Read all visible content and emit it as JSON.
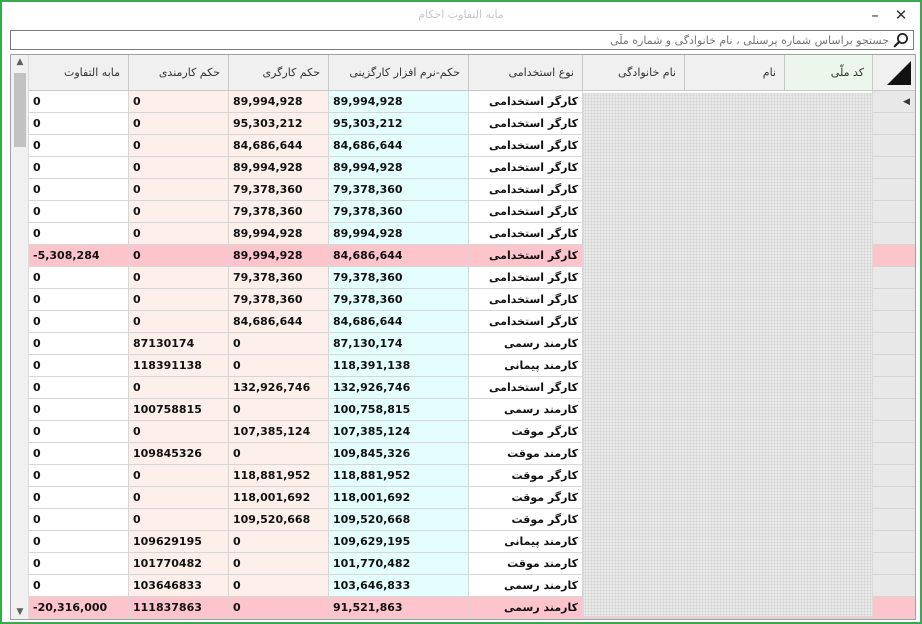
{
  "window": {
    "title": "مابه التفاوت احکام",
    "minimize_icon": "minimize-icon",
    "close_icon": "close-icon"
  },
  "search": {
    "placeholder": "جستجو براساس شماره پرسنلی ، نام خانوادگی و شماره ملّی",
    "icon": "search-icon"
  },
  "table": {
    "columns": {
      "national_code": "کد ملّی",
      "first_name": "نام",
      "last_name": "نام خانوادگی",
      "employment_type": "نوع استخدامی",
      "software_ruling": "حکم-نرم افزار کارگزینی",
      "worker_ruling": "حکم کارگری",
      "employee_ruling": "حکم کارمندی",
      "difference": "مابه التفاوت"
    },
    "rows": [
      {
        "type": "کارگر استخدامی",
        "software": "89,994,928",
        "worker": "89,994,928",
        "employee": "0",
        "diff": "0",
        "highlight": false
      },
      {
        "type": "کارگر استخدامی",
        "software": "95,303,212",
        "worker": "95,303,212",
        "employee": "0",
        "diff": "0",
        "highlight": false
      },
      {
        "type": "کارگر استخدامی",
        "software": "84,686,644",
        "worker": "84,686,644",
        "employee": "0",
        "diff": "0",
        "highlight": false
      },
      {
        "type": "کارگر استخدامی",
        "software": "89,994,928",
        "worker": "89,994,928",
        "employee": "0",
        "diff": "0",
        "highlight": false
      },
      {
        "type": "کارگر استخدامی",
        "software": "79,378,360",
        "worker": "79,378,360",
        "employee": "0",
        "diff": "0",
        "highlight": false
      },
      {
        "type": "کارگر استخدامی",
        "software": "79,378,360",
        "worker": "79,378,360",
        "employee": "0",
        "diff": "0",
        "highlight": false
      },
      {
        "type": "کارگر استخدامی",
        "software": "89,994,928",
        "worker": "89,994,928",
        "employee": "0",
        "diff": "0",
        "highlight": false
      },
      {
        "type": "کارگر استخدامی",
        "software": "84,686,644",
        "worker": "89,994,928",
        "employee": "0",
        "diff": "-5,308,284",
        "highlight": true
      },
      {
        "type": "کارگر استخدامی",
        "software": "79,378,360",
        "worker": "79,378,360",
        "employee": "0",
        "diff": "0",
        "highlight": false
      },
      {
        "type": "کارگر استخدامی",
        "software": "79,378,360",
        "worker": "79,378,360",
        "employee": "0",
        "diff": "0",
        "highlight": false
      },
      {
        "type": "کارگر استخدامی",
        "software": "84,686,644",
        "worker": "84,686,644",
        "employee": "0",
        "diff": "0",
        "highlight": false
      },
      {
        "type": "کارمند رسمی",
        "software": "87,130,174",
        "worker": "0",
        "employee": "87130174",
        "diff": "0",
        "highlight": false
      },
      {
        "type": "کارمند پیمانی",
        "software": "118,391,138",
        "worker": "0",
        "employee": "118391138",
        "diff": "0",
        "highlight": false
      },
      {
        "type": "کارگر استخدامی",
        "software": "132,926,746",
        "worker": "132,926,746",
        "employee": "0",
        "diff": "0",
        "highlight": false
      },
      {
        "type": "کارمند رسمی",
        "software": "100,758,815",
        "worker": "0",
        "employee": "100758815",
        "diff": "0",
        "highlight": false
      },
      {
        "type": "کارگر موقت",
        "software": "107,385,124",
        "worker": "107,385,124",
        "employee": "0",
        "diff": "0",
        "highlight": false
      },
      {
        "type": "کارمند موقت",
        "software": "109,845,326",
        "worker": "0",
        "employee": "109845326",
        "diff": "0",
        "highlight": false
      },
      {
        "type": "کارگر موقت",
        "software": "118,881,952",
        "worker": "118,881,952",
        "employee": "0",
        "diff": "0",
        "highlight": false
      },
      {
        "type": "کارگر موقت",
        "software": "118,001,692",
        "worker": "118,001,692",
        "employee": "0",
        "diff": "0",
        "highlight": false
      },
      {
        "type": "کارگر موقت",
        "software": "109,520,668",
        "worker": "109,520,668",
        "employee": "0",
        "diff": "0",
        "highlight": false
      },
      {
        "type": "کارمند پیمانی",
        "software": "109,629,195",
        "worker": "0",
        "employee": "109629195",
        "diff": "0",
        "highlight": false
      },
      {
        "type": "کارمند موقت",
        "software": "101,770,482",
        "worker": "0",
        "employee": "101770482",
        "diff": "0",
        "highlight": false
      },
      {
        "type": "کارمند رسمی",
        "software": "103,646,833",
        "worker": "0",
        "employee": "103646833",
        "diff": "0",
        "highlight": false
      },
      {
        "type": "کارمند رسمی",
        "software": "91,521,863",
        "worker": "0",
        "employee": "111837863",
        "diff": "-20,316,000",
        "highlight": true
      }
    ]
  },
  "colors": {
    "window_border": "#3aa84f",
    "highlight_row": "#fdc4cc",
    "software_column": "#e4fdfd",
    "ruling_columns": "#fdf0ea"
  }
}
